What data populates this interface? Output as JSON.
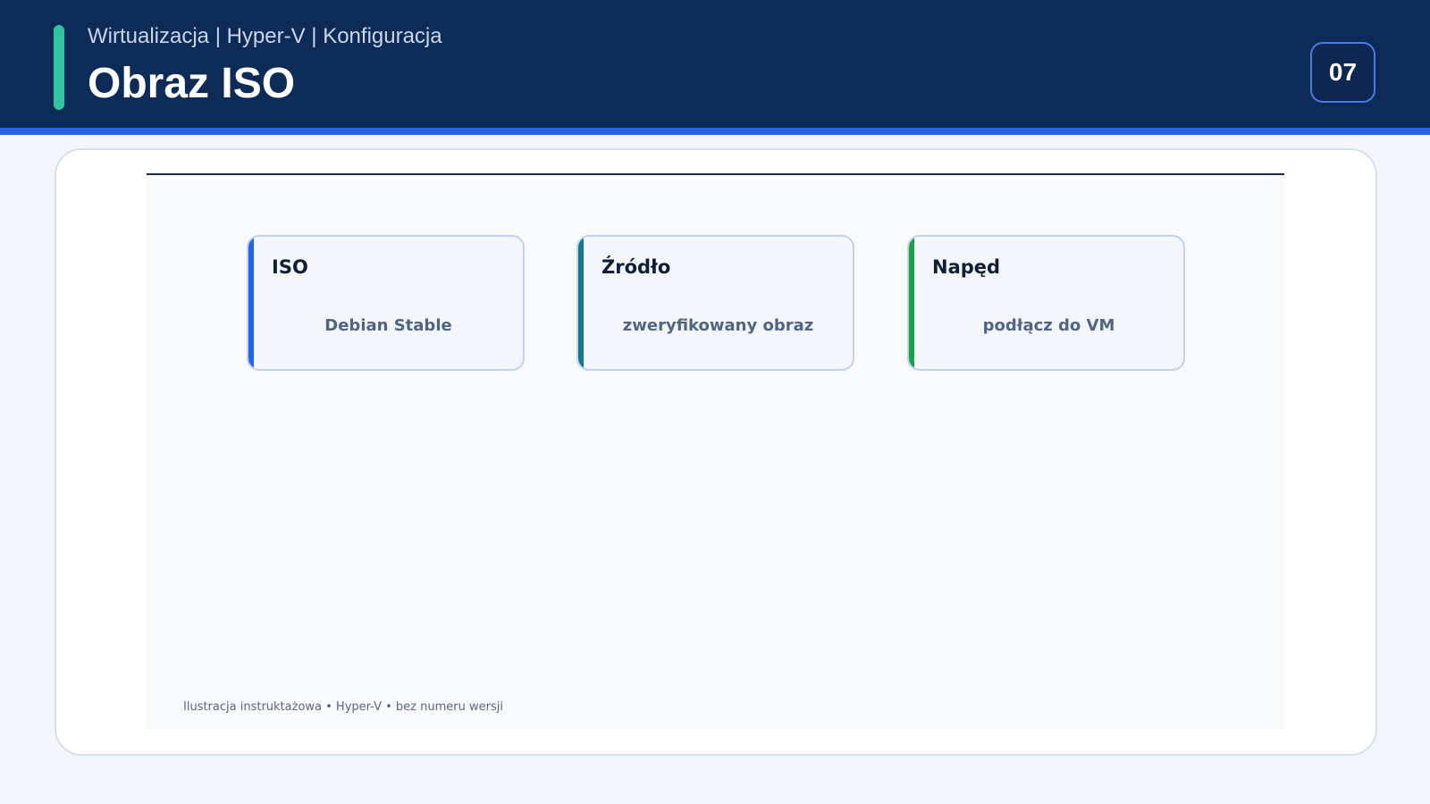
{
  "header": {
    "breadcrumb": "Wirtualizacja | Hyper-V | Konfiguracja",
    "title": "Obraz ISO",
    "slide_number": "07"
  },
  "cards": [
    {
      "title": "ISO",
      "value": "Debian Stable",
      "accent": "#2563eb"
    },
    {
      "title": "Źródło",
      "value": "zweryfikowany obraz",
      "accent": "#117a8b"
    },
    {
      "title": "Napęd",
      "value": "podłącz do VM",
      "accent": "#16a34a"
    }
  ],
  "footer": {
    "note": "Ilustracja instruktażowa • Hyper-V • bez numeru wersji"
  },
  "colors": {
    "header_bg": "#0d2b57",
    "header_stripe": "#2563eb",
    "header_accent": "#34c3a0"
  }
}
